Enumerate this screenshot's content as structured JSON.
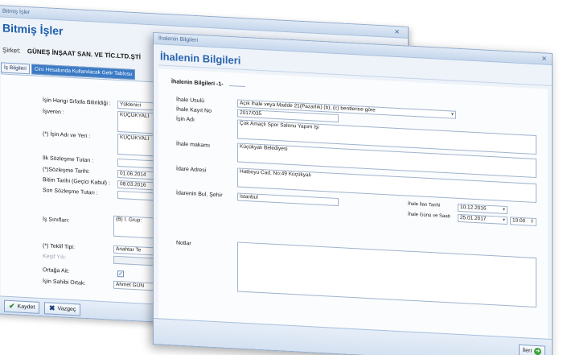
{
  "back_window": {
    "window_title": "Bitmiş İşler",
    "heading": "Bitmiş İşler",
    "company_label": "Şirket:",
    "company_name": "GÜNEŞ İNŞAAT SAN. VE TİC.LTD.ŞTİ",
    "tabs": [
      "İş Bilgileri",
      "Ciro Hesabında Kullanılacak Gelir Tablosu"
    ],
    "fields": {
      "capacity_label": "İşin Hangi Sıfatla Bitirildiği :",
      "capacity_value": "Yüklenici",
      "employer_label": "İşveren :",
      "employer_value": "KÜÇÜKYALI",
      "job_name_label": "(*) İşin Adı ve Yeri :",
      "job_name_value": "KÜÇÜKYALI",
      "first_contract_label": "İlk Sözleşme Tutarı :",
      "first_contract_value": "",
      "contract_date_label": "(*)Sözleşme Tarihi:",
      "contract_date_value": "01.06.2014",
      "end_date_label": "Bitim Tarihi (Geçici Kabul) :",
      "end_date_value": "08.03.2016",
      "last_contract_label": "Son Sözleşme Tutarı :",
      "last_contract_value": "",
      "job_class_label": "İş Sınıfları:",
      "job_class_value": "(B) I. Grup:",
      "offer_type_label": "(*) Teklif Tipi:",
      "offer_type_value": "Anahtar Te",
      "discovery_year_label": "Keşif Yılı:",
      "partnership_label": "Ortağa Ait:",
      "partnership_check": "✓",
      "owner_partner_label": "İşin Sahibi Ortak:",
      "owner_partner_value": "Ahmet GÜN"
    },
    "save_label": "Kaydet",
    "cancel_label": "Vazgeç"
  },
  "front_window": {
    "window_title": "İhalenin Bilgileri",
    "heading": "İhalenin Bilgileri",
    "group_title": "İhalenin Bilgileri -1-",
    "fields": {
      "procedure_label": "İhale Usulü",
      "procedure_value": "Açık İhale veya Madde 21(Pazarlık) (b), (c) bentlerine göre",
      "record_no_label": "İhale Kayıt No",
      "record_no_value": "2017/035",
      "job_name_label": "İşin Adı",
      "job_name_value": "Çok Amaçlı Spor Salonu Yapım İşi",
      "authority_label": "İhale makamı",
      "authority_value": "Küçükyalı Belediyesi",
      "admin_address_label": "İdare Adresi",
      "admin_address_value": "Hatboyu Cad. No:49 Küçükyalı",
      "admin_city_label": "İdarenin Bul. Şehir",
      "admin_city_value": "İstanbul",
      "announce_date_label": "İhale İlan Tarihi",
      "announce_date_value": "10.12.2016",
      "tender_date_label": "İhale Günü ve Saati",
      "tender_date_value": "25.01.2017",
      "tender_time_value": "10:00",
      "notes_label": "Notlar",
      "notes_value": ""
    },
    "next_label": "İleri"
  }
}
